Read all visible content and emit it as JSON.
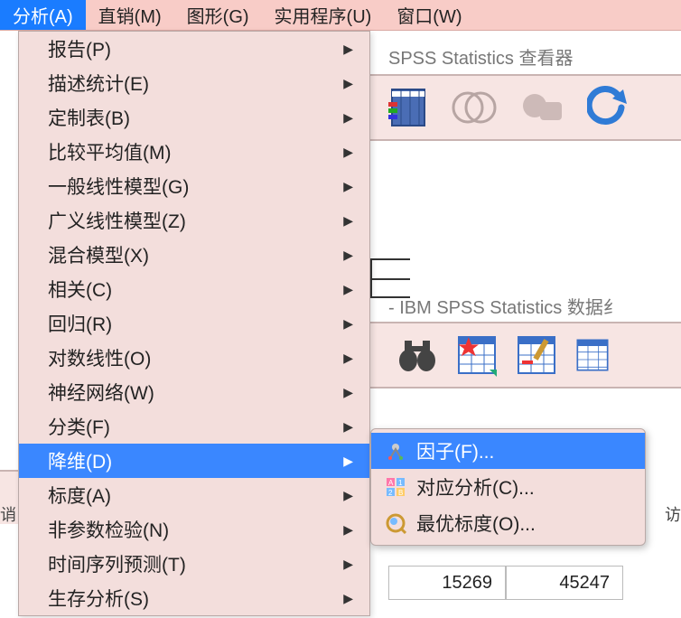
{
  "menubar": [
    {
      "label": "分析(A)",
      "active": true
    },
    {
      "label": "直销(M)"
    },
    {
      "label": "图形(G)"
    },
    {
      "label": "实用程序(U)"
    },
    {
      "label": "窗口(W)"
    }
  ],
  "viewer_title": "SPSS Statistics 查看器",
  "dataset_title": "- IBM SPSS Statistics 数据纟",
  "dropdown": [
    {
      "label": "报告(P)",
      "sub": true
    },
    {
      "label": "描述统计(E)",
      "sub": true
    },
    {
      "label": "定制表(B)",
      "sub": true
    },
    {
      "label": "比较平均值(M)",
      "sub": true
    },
    {
      "label": "一般线性模型(G)",
      "sub": true
    },
    {
      "label": "广义线性模型(Z)",
      "sub": true
    },
    {
      "label": "混合模型(X)",
      "sub": true
    },
    {
      "label": "相关(C)",
      "sub": true
    },
    {
      "label": "回归(R)",
      "sub": true
    },
    {
      "label": "对数线性(O)",
      "sub": true
    },
    {
      "label": "神经网络(W)",
      "sub": true
    },
    {
      "label": "分类(F)",
      "sub": true
    },
    {
      "label": "降维(D)",
      "sub": true,
      "highlight": true
    },
    {
      "label": "标度(A)",
      "sub": true
    },
    {
      "label": "非参数检验(N)",
      "sub": true
    },
    {
      "label": "时间序列预测(T)",
      "sub": true
    },
    {
      "label": "生存分析(S)",
      "sub": true
    }
  ],
  "submenu": [
    {
      "label": "因子(F)...",
      "icon": "factor",
      "highlight": true
    },
    {
      "label": "对应分析(C)...",
      "icon": "correspond"
    },
    {
      "label": "最优标度(O)...",
      "icon": "optimal"
    }
  ],
  "left_label": "诮",
  "right_label": "访",
  "table_cells": [
    "15269",
    "45247"
  ]
}
